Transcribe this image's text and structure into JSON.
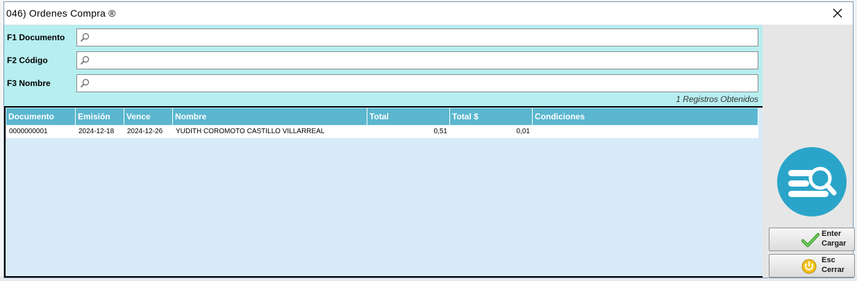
{
  "window": {
    "title": "046) Ordenes Compra ®"
  },
  "search": {
    "fields": [
      {
        "label": "F1  Documento",
        "value": "",
        "placeholder": ""
      },
      {
        "label": "F2  Código",
        "value": "",
        "placeholder": ""
      },
      {
        "label": "F3  Nombre",
        "value": "",
        "placeholder": ""
      }
    ],
    "records_text": "1 Registros Obtenidos"
  },
  "grid": {
    "columns": [
      "Documento",
      "Emisión",
      "Vence",
      "Nombre",
      "Total",
      "Total $",
      "Condiciones"
    ],
    "rows": [
      [
        "0000000001",
        "2024-12-18",
        "2024-12-26",
        "YUDITH COROMOTO CASTILLO VILLARREAL",
        "0,51",
        "0,01",
        ""
      ]
    ]
  },
  "actions": {
    "load": {
      "key": "Enter",
      "label": "Cargar",
      "icon": "checkmark-icon"
    },
    "close": {
      "key": "Esc",
      "label": "Cerrar",
      "icon": "power-icon"
    }
  },
  "colors": {
    "search_panel_bg": "#b7eef0",
    "grid_header_bg": "#5bb6cf",
    "grid_body_bg": "#d7ebf8",
    "search_icon_bg": "#2aa5c9"
  },
  "icons": {
    "close": "close-icon",
    "field": "magnifier-icon",
    "search_logo": "search-list-icon"
  }
}
